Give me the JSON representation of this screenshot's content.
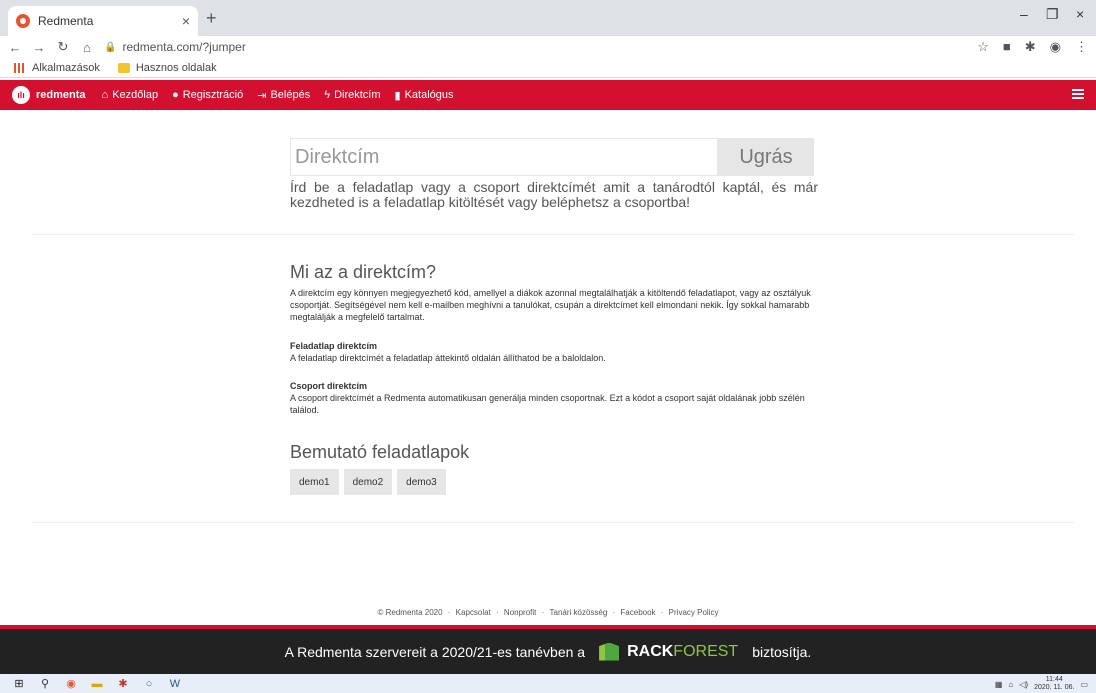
{
  "browser": {
    "tab_title": "Redmenta",
    "url": "redmenta.com/?jumper",
    "bookmarks": [
      "Alkalmazások",
      "Hasznos oldalak"
    ]
  },
  "nav": {
    "logo": "redmenta",
    "items": [
      "Kezdőlap",
      "Regisztráció",
      "Belépés",
      "Direktcím",
      "Katalógus"
    ]
  },
  "jumper": {
    "placeholder": "Direktcím",
    "button": "Ugrás",
    "help": "Írd be a feladatlap vagy a csoport direktcímét amit a tanárodtól kaptál, és már kezdheted is a feladatlap kitöltését vagy beléphetsz a csoportba!"
  },
  "info": {
    "title": "Mi az a direktcím?",
    "intro": "A direktcím egy könnyen megjegyezhető kód, amellyel a diákok azonnal megtalálhatják a kitöltendő feladatlapot, vagy az osztályuk csoportját. Segítségével nem kell e-mailben meghívni a tanulókat, csupán a direktcímet kell elmondani nekik. Így sokkal hamarabb megtalálják a megfelelő tartalmat.",
    "ws_title": "Feladatlap direktcím",
    "ws_text": "A feladatlap direktcímét a feladatlap áttekintő oldalán állíthatod be a baloldalon.",
    "group_title": "Csoport direktcím",
    "group_text": "A csoport direktcímét a Redmenta automatikusan generálja minden csoportnak. Ezt a kódot a csoport saját oldalának jobb szélén találod."
  },
  "demos": {
    "title": "Bemutató feladatlapok",
    "items": [
      "demo1",
      "demo2",
      "demo3"
    ]
  },
  "footer": {
    "links": [
      "© Redmenta 2020",
      "Kapcsolat",
      "Nonprofit",
      "Tanári közösség",
      "Facebook",
      "Privacy Policy"
    ],
    "sponsor_before": "A Redmenta szervereit a 2020/21-es tanévben a",
    "rack1": "RACK",
    "rack2": "FOREST",
    "sponsor_after": "biztosítja."
  },
  "taskbar": {
    "time": "11:44",
    "date": "2020. 11. 06."
  }
}
